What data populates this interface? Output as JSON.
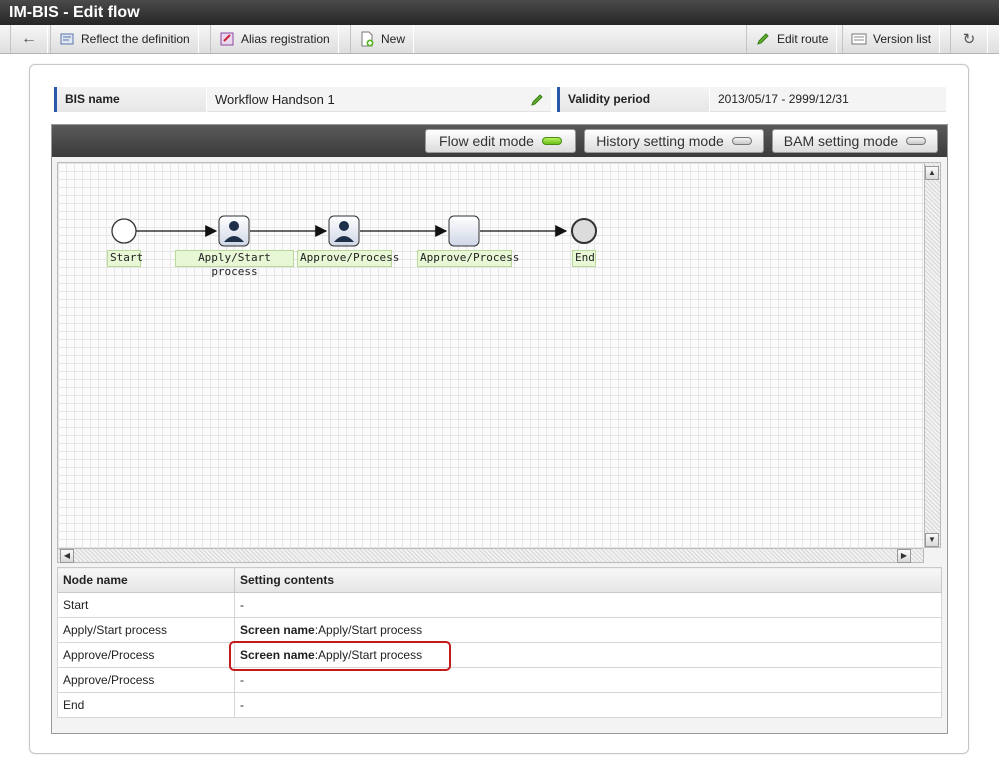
{
  "window": {
    "title": "IM-BIS - Edit flow"
  },
  "toolbar": {
    "reflect_label": "Reflect the definition",
    "alias_label": "Alias registration",
    "new_label": "New",
    "edit_route_label": "Edit route",
    "version_list_label": "Version list"
  },
  "info": {
    "bis_name_label": "BIS name",
    "bis_name_value": "Workflow Handson 1",
    "validity_label": "Validity period",
    "validity_value": "2013/05/17 - 2999/12/31"
  },
  "modes": {
    "flow_edit": "Flow edit mode",
    "history_setting": "History setting mode",
    "bam_setting": "BAM setting mode",
    "active": "flow_edit"
  },
  "flow": {
    "nodes": [
      {
        "label": "Start",
        "kind": "start"
      },
      {
        "label": "Apply/Start process",
        "kind": "user-task"
      },
      {
        "label": "Approve/Process",
        "kind": "user-task"
      },
      {
        "label": "Approve/Process",
        "kind": "task"
      },
      {
        "label": "End",
        "kind": "end"
      }
    ]
  },
  "table": {
    "headers": [
      "Node name",
      "Setting contents"
    ],
    "rows": [
      {
        "node": "Start",
        "key": "",
        "value": "-"
      },
      {
        "node": "Apply/Start process",
        "key": "Screen name",
        "value": ":Apply/Start process"
      },
      {
        "node": "Approve/Process",
        "key": "Screen name",
        "value": ":Apply/Start process"
      },
      {
        "node": "Approve/Process",
        "key": "",
        "value": "-"
      },
      {
        "node": "End",
        "key": "",
        "value": "-"
      }
    ]
  },
  "colors": {
    "accent": "#2a59a8",
    "highlight": "#c41a1a",
    "mode_on": "#6cc11b"
  }
}
